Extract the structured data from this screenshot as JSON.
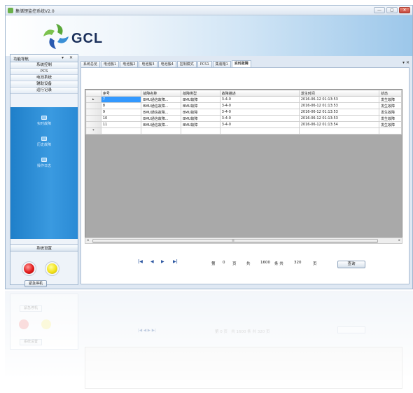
{
  "window": {
    "title": "集储锂监控系统V2.0",
    "buttons": [
      "—",
      "▢",
      "✕"
    ]
  },
  "header": {
    "logo_text": "GCL"
  },
  "left_panel": {
    "title": "功能导航",
    "controls": "▾ ✕",
    "items": [
      {
        "label": "系统控制"
      },
      {
        "label": "PCS"
      },
      {
        "label": "电池系统"
      },
      {
        "label": "辅助设备"
      },
      {
        "label": "运行记录"
      }
    ],
    "sub_items": [
      {
        "label": "实时故障",
        "icon": "record-icon"
      },
      {
        "label": "历史故障",
        "icon": "record-icon"
      },
      {
        "label": "操作日志",
        "icon": "record-icon"
      }
    ],
    "settings_label": "系统设置",
    "lamps": [
      {
        "name": "red",
        "color": "#e21a1a"
      },
      {
        "name": "yellow",
        "color": "#f3e21a"
      }
    ],
    "estop_label": "紧急停机"
  },
  "tabs": {
    "items": [
      {
        "label": "系统总览"
      },
      {
        "label": "电池簇1"
      },
      {
        "label": "电池簇2"
      },
      {
        "label": "电池簇3"
      },
      {
        "label": "电池簇4"
      },
      {
        "label": "控制模式"
      },
      {
        "label": "PCS1"
      },
      {
        "label": "集装箱1"
      },
      {
        "label": "实时故障"
      }
    ],
    "active_index": 8,
    "more": "▾ ✕"
  },
  "grid": {
    "columns": [
      "序号",
      "故障名称",
      "故障类型",
      "故障描述",
      "发生时间",
      "状态"
    ],
    "rows": [
      [
        "7",
        "BMU通信故障...",
        "BMU故障",
        "3-4-0",
        "2016-06-12 01:13:53",
        "发生故障"
      ],
      [
        "8",
        "BMU通信故障...",
        "BMU故障",
        "3-4-0",
        "2016-06-12 01:13:53",
        "发生故障"
      ],
      [
        "9",
        "BMU通信故障...",
        "BMU故障",
        "3-4-0",
        "2016-06-12 01:13:53",
        "发生故障"
      ],
      [
        "10",
        "BMU通信故障...",
        "BMU故障",
        "3-4-0",
        "2016-06-12 01:13:53",
        "发生故障"
      ],
      [
        "11",
        "BMU通信故障...",
        "BMU故障",
        "3-4-0",
        "2016-06-12 01:13:54",
        "发生故障"
      ]
    ],
    "row_marker": "▸",
    "new_row_marker": "*",
    "scroll_center": "≡"
  },
  "pager": {
    "first": "|◀",
    "prev": "◀",
    "next": "▶",
    "last": "▶|",
    "page_prefix": "第",
    "page_value": "0",
    "page_suffix": "页",
    "total_prefix": "共",
    "total_records": "1600",
    "records_suffix": "条 共",
    "total_pages": "320",
    "pages_suffix": "页",
    "query_label": "查询"
  }
}
